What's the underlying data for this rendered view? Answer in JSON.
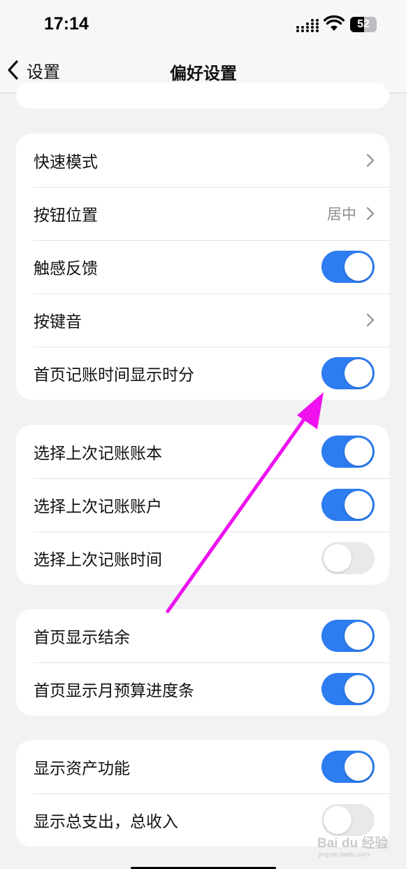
{
  "status_bar": {
    "time": "17:14",
    "battery_level": "52",
    "battery_fraction": 0.52,
    "icons": [
      "signal-icon",
      "wifi-icon",
      "battery-icon"
    ]
  },
  "nav": {
    "back_label": "设置",
    "title": "偏好设置"
  },
  "colors": {
    "toggle_on": "#2d7cf0",
    "toggle_off": "#e9e9eb",
    "annotation_arrow": "#ee11ee"
  },
  "groups": [
    {
      "rows": [
        {
          "label": "快速模式",
          "control": "chevron"
        },
        {
          "label": "按钮位置",
          "value": "居中",
          "control": "chevron"
        },
        {
          "label": "触感反馈",
          "control": "toggle",
          "on": true
        },
        {
          "label": "按键音",
          "control": "chevron"
        },
        {
          "label": "首页记账时间显示时分",
          "control": "toggle",
          "on": true
        }
      ]
    },
    {
      "rows": [
        {
          "label": "选择上次记账账本",
          "control": "toggle",
          "on": true
        },
        {
          "label": "选择上次记账账户",
          "control": "toggle",
          "on": true
        },
        {
          "label": "选择上次记账时间",
          "control": "toggle",
          "on": false
        }
      ]
    },
    {
      "rows": [
        {
          "label": "首页显示结余",
          "control": "toggle",
          "on": true
        },
        {
          "label": "首页显示月预算进度条",
          "control": "toggle",
          "on": true
        }
      ]
    },
    {
      "rows": [
        {
          "label": "显示资产功能",
          "control": "toggle",
          "on": true
        },
        {
          "label": "显示总支出，总收入",
          "control": "toggle",
          "on": false
        }
      ]
    }
  ],
  "watermark": {
    "text": "Bai du 经验",
    "subtext": "jingyan.baidu.com"
  }
}
